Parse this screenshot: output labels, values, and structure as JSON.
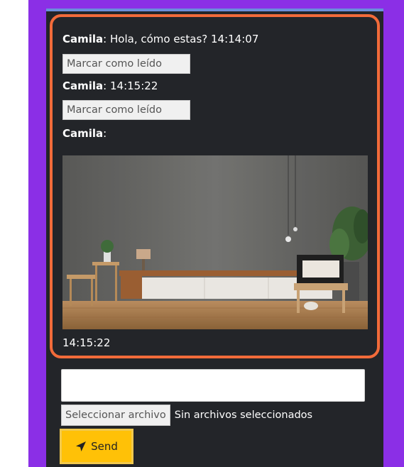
{
  "chat": {
    "messages": [
      {
        "sender": "Camila",
        "separator": ": ",
        "text": "Hola, cómo estas? 14:14:07"
      },
      {
        "sender": "Camila",
        "separator": ": ",
        "text": "14:15:22"
      },
      {
        "sender": "Camila",
        "separator": ":",
        "text": ""
      }
    ],
    "mark_read_label": "Marcar como leído",
    "image_timestamp": "14:15:22"
  },
  "composer": {
    "text_value": "",
    "file_button_label": "Seleccionar archivo",
    "file_status": "Sin archivos seleccionados",
    "send_label": "Send",
    "send_icon": "paper-plane-icon"
  },
  "colors": {
    "background_purple": "#8b2fe6",
    "panel_dark": "#232529",
    "chat_border": "#f26b3a",
    "send_button": "#ffc107"
  }
}
